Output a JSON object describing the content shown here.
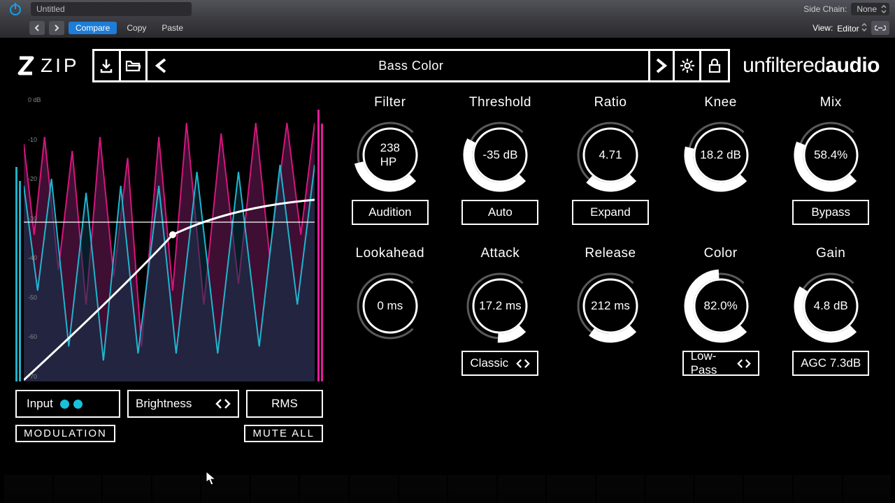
{
  "host": {
    "preset_name": "Untitled",
    "compare": "Compare",
    "copy": "Copy",
    "paste": "Paste",
    "sidechain_label": "Side Chain:",
    "sidechain_value": "None",
    "view_label": "View:",
    "view_value": "Editor"
  },
  "plugin": {
    "logo": "ZIP",
    "preset": "Bass Color",
    "brand_light": "unfiltered",
    "brand_bold": "audio"
  },
  "scope": {
    "db_ticks": [
      "0 dB",
      "-10",
      "-20",
      "-30",
      "-40",
      "-50",
      "-60",
      "-70"
    ]
  },
  "left_buttons": {
    "input": "Input",
    "mode": "Brightness",
    "detector": "RMS",
    "modulation": "MODULATION",
    "mute_all": "MUTE ALL"
  },
  "knobs_row1": [
    {
      "label": "Filter",
      "value": "238",
      "sub": "HP",
      "fill": 0.45,
      "button": "Audition"
    },
    {
      "label": "Threshold",
      "value": "-35 dB",
      "sub": "",
      "fill": 0.6,
      "button": "Auto"
    },
    {
      "label": "Ratio",
      "value": "4.71",
      "sub": "",
      "fill": 0.32,
      "button": "Expand"
    },
    {
      "label": "Knee",
      "value": "18.2 dB",
      "sub": "",
      "fill": 0.55,
      "button": ""
    },
    {
      "label": "Mix",
      "value": "58.4%",
      "sub": "",
      "fill": 0.58,
      "button": "Bypass"
    }
  ],
  "knobs_row2": [
    {
      "label": "Lookahead",
      "value": "0 ms",
      "sub": "",
      "fill": 0.0,
      "button": ""
    },
    {
      "label": "Attack",
      "value": "17.2 ms",
      "sub": "",
      "fill": 0.18,
      "button": "Classic",
      "selector": true
    },
    {
      "label": "Release",
      "value": "212 ms",
      "sub": "",
      "fill": 0.3,
      "button": ""
    },
    {
      "label": "Color",
      "value": "82.0%",
      "sub": "",
      "fill": 0.82,
      "button": "Low-Pass",
      "selector": true
    },
    {
      "label": "Gain",
      "value": "4.8 dB",
      "sub": "",
      "fill": 0.62,
      "button": "AGC 7.3dB"
    }
  ]
}
